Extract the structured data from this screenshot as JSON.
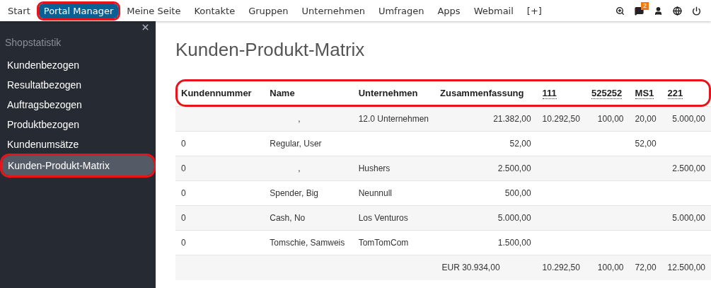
{
  "topnav": {
    "items": [
      {
        "label": "Start",
        "selected": false,
        "highlighted": false
      },
      {
        "label": "Portal Manager",
        "selected": true,
        "highlighted": true
      },
      {
        "label": "Meine Seite",
        "selected": false,
        "highlighted": false
      },
      {
        "label": "Kontakte",
        "selected": false,
        "highlighted": false
      },
      {
        "label": "Gruppen",
        "selected": false,
        "highlighted": false
      },
      {
        "label": "Unternehmen",
        "selected": false,
        "highlighted": false
      },
      {
        "label": "Umfragen",
        "selected": false,
        "highlighted": false
      },
      {
        "label": "Apps",
        "selected": false,
        "highlighted": false
      },
      {
        "label": "Webmail",
        "selected": false,
        "highlighted": false
      },
      {
        "label": "[+]",
        "selected": false,
        "highlighted": false
      }
    ],
    "icons": [
      {
        "kind": "search"
      },
      {
        "kind": "messages",
        "badge": "2"
      },
      {
        "kind": "user"
      },
      {
        "kind": "globe"
      },
      {
        "kind": "power"
      }
    ]
  },
  "sidebar": {
    "section": "Shopstatistik",
    "items": [
      {
        "label": "Kundenbezogen",
        "selected": false,
        "highlighted": false
      },
      {
        "label": "Resultatbezogen",
        "selected": false,
        "highlighted": false
      },
      {
        "label": "Auftragsbezogen",
        "selected": false,
        "highlighted": false
      },
      {
        "label": "Produktbezogen",
        "selected": false,
        "highlighted": false
      },
      {
        "label": "Kundenumsätze",
        "selected": false,
        "highlighted": false
      },
      {
        "label": "Kunden-Produkt-Matrix",
        "selected": true,
        "highlighted": true
      }
    ]
  },
  "page_title": "Kunden-Produkt-Matrix",
  "table": {
    "header_highlighted": true,
    "columns": [
      {
        "label": "Kundennummer",
        "kind": "text"
      },
      {
        "label": "Name",
        "kind": "text"
      },
      {
        "label": "Unternehmen",
        "kind": "text"
      },
      {
        "label": "Zusammenfassung",
        "kind": "sum"
      },
      {
        "label": "111",
        "kind": "product"
      },
      {
        "label": "525252",
        "kind": "product"
      },
      {
        "label": "MS1",
        "kind": "product"
      },
      {
        "label": "221",
        "kind": "product"
      }
    ],
    "rows": [
      {
        "kind": "data",
        "cells": [
          null,
          ",",
          "12.0 Unternehmen",
          "21.382,00",
          "10.292,50",
          "100,00",
          "20,00",
          "5.000,00"
        ]
      },
      {
        "kind": "data",
        "cells": [
          "0",
          "Regular, User",
          null,
          "52,00",
          null,
          null,
          "52,00",
          null
        ]
      },
      {
        "kind": "data",
        "cells": [
          "0",
          ",",
          "Hushers",
          "2.500,00",
          null,
          null,
          null,
          "2.500,00"
        ]
      },
      {
        "kind": "data",
        "cells": [
          "0",
          "Spender, Big",
          "Neunnull",
          "500,00",
          null,
          null,
          null,
          null
        ]
      },
      {
        "kind": "data",
        "cells": [
          "0",
          "Cash, No",
          "Los Venturos",
          "5.000,00",
          null,
          null,
          null,
          "5.000,00"
        ]
      },
      {
        "kind": "data",
        "cells": [
          "0",
          "Tomschie, Samweis",
          "TomTomCom",
          "1.500,00",
          null,
          null,
          null,
          null
        ]
      },
      {
        "kind": "total",
        "cells": [
          null,
          null,
          null,
          "EUR 30.934,00",
          "10.292,50",
          "100,00",
          "72,00",
          "12.500,00"
        ]
      }
    ]
  }
}
